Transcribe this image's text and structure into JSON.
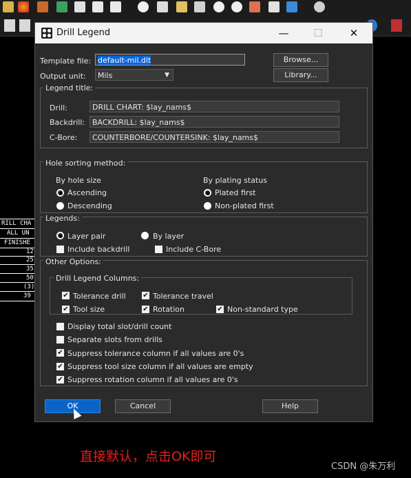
{
  "dialog": {
    "title": "Drill Legend",
    "window_buttons": {
      "minimize": "—",
      "maximize": "☐",
      "close": "✕"
    },
    "template_file": {
      "label": "Template file:",
      "value": "default-mil.dlt"
    },
    "output_unit": {
      "label": "Output unit:",
      "value": "Mils"
    },
    "browse_label": "Browse...",
    "library_label": "Library...",
    "legend_title": {
      "group_label": "Legend title:",
      "drill_label": "Drill:",
      "drill_value": "DRILL CHART: $lay_nams$",
      "backdrill_label": "Backdrill:",
      "backdrill_value": "BACKDRILL: $lay_nams$",
      "cbore_label": "C-Bore:",
      "cbore_value": "COUNTERBORE/COUNTERSINK: $lay_nams$"
    },
    "hole_sorting": {
      "group_label": "Hole sorting method:",
      "by_hole_size": "By hole size",
      "ascending": "Ascending",
      "descending": "Descending",
      "by_plating": "By plating status",
      "plated_first": "Plated first",
      "nonplated_first": "Non-plated first"
    },
    "legends": {
      "group_label": "Legends:",
      "layer_pair": "Layer pair",
      "by_layer": "By layer",
      "include_backdrill": "Include backdrill",
      "include_cbore": "Include C-Bore"
    },
    "other_options": {
      "group_label": "Other Options:",
      "columns_label": "Drill Legend Columns:",
      "tolerance_drill": "Tolerance drill",
      "tolerance_travel": "Tolerance travel",
      "tool_size": "Tool size",
      "rotation": "Rotation",
      "nonstandard_type": "Non-standard type",
      "display_total": "Display total slot/drill count",
      "separate_slots": "Separate slots from drills",
      "suppress_tolerance": "Suppress tolerance column if all values are 0's",
      "suppress_tool_size": "Suppress tool size column if all values are empty",
      "suppress_rotation": "Suppress rotation column if all values are 0's"
    },
    "ok_label": "OK",
    "cancel_label": "Cancel",
    "help_label": "Help",
    "check_mark": "✔"
  },
  "background_chart": {
    "rows": [
      "RILL CHA",
      "ALL UN",
      "FINISHE",
      "12",
      "25",
      "35",
      "50",
      "(3)",
      "39"
    ]
  },
  "caption": "直接默认，点击OK即可",
  "watermark": "CSDN @朱万利",
  "colors": {
    "accent": "#0a64c8",
    "caption": "#e8201c"
  }
}
